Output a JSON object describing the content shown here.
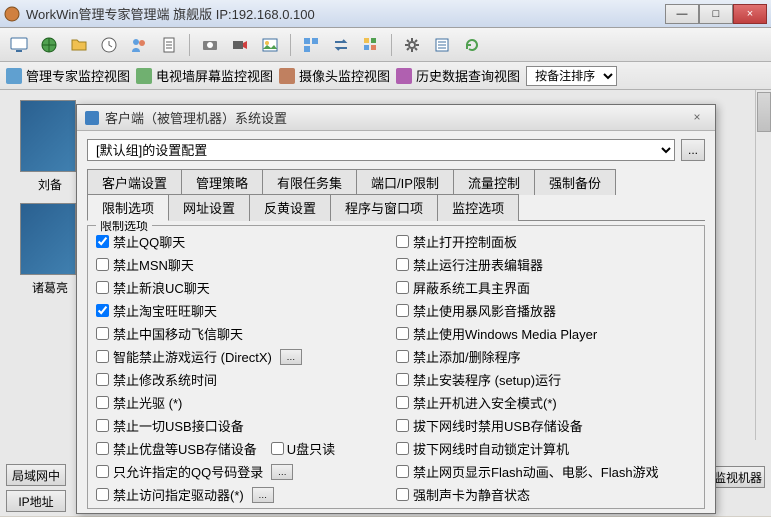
{
  "window": {
    "title": "WorkWin管理专家管理端    旗舰版 IP:192.168.0.100",
    "min": "—",
    "max": "□",
    "close": "×"
  },
  "viewbar": {
    "v1": "管理专家监控视图",
    "v2": "电视墙屏幕监控视图",
    "v3": "摄像头监控视图",
    "v4": "历史数据查询视图",
    "sort": "按备注排序"
  },
  "thumbs": {
    "t1": "刘备",
    "t2": "诸葛亮"
  },
  "bottom": {
    "lan": "局域网中",
    "ip": "IP地址",
    "monitor": "监视机器"
  },
  "dialog": {
    "title": "客户端（被管理机器）系统设置",
    "close": "×",
    "config_combo": "[默认组]的设置配置",
    "config_btn": "...",
    "tabs_row1": [
      "客户端设置",
      "管理策略",
      "有限任务集",
      "端口/IP限制",
      "流量控制",
      "强制备份"
    ],
    "tabs_row2": [
      "限制选项",
      "网址设置",
      "反黄设置",
      "程序与窗口项",
      "监控选项"
    ],
    "group_legend": "限制选项",
    "left_checks": [
      {
        "label": "禁止QQ聊天",
        "checked": true
      },
      {
        "label": "禁止MSN聊天",
        "checked": false
      },
      {
        "label": "禁止新浪UC聊天",
        "checked": false
      },
      {
        "label": "禁止淘宝旺旺聊天",
        "checked": true
      },
      {
        "label": "禁止中国移动飞信聊天",
        "checked": false
      },
      {
        "label": "智能禁止游戏运行 (DirectX)",
        "checked": false,
        "btn": true
      },
      {
        "label": "禁止修改系统时间",
        "checked": false
      },
      {
        "label": "禁止光驱 (*)",
        "checked": false
      },
      {
        "label": "禁止一切USB接口设备",
        "checked": false
      },
      {
        "label": "禁止优盘等USB存储设备",
        "checked": false,
        "inline": "U盘只读"
      },
      {
        "label": "只允许指定的QQ号码登录",
        "checked": false,
        "btn": true
      },
      {
        "label": "禁止访问指定驱动器(*)",
        "checked": false,
        "btn": true
      }
    ],
    "right_checks": [
      {
        "label": "禁止打开控制面板",
        "checked": false
      },
      {
        "label": "禁止运行注册表编辑器",
        "checked": false
      },
      {
        "label": "屏蔽系统工具主界面",
        "checked": false
      },
      {
        "label": "禁止使用暴风影音播放器",
        "checked": false
      },
      {
        "label": "禁止使用Windows Media Player",
        "checked": false
      },
      {
        "label": "禁止添加/删除程序",
        "checked": false
      },
      {
        "label": "禁止安装程序 (setup)运行",
        "checked": false
      },
      {
        "label": "禁止开机进入安全模式(*)",
        "checked": false
      },
      {
        "label": "拔下网线时禁用USB存储设备",
        "checked": false
      },
      {
        "label": "拔下网线时自动锁定计算机",
        "checked": false
      },
      {
        "label": "禁止网页显示Flash动画、电影、Flash游戏",
        "checked": false
      },
      {
        "label": "强制声卡为静音状态",
        "checked": false
      }
    ]
  }
}
